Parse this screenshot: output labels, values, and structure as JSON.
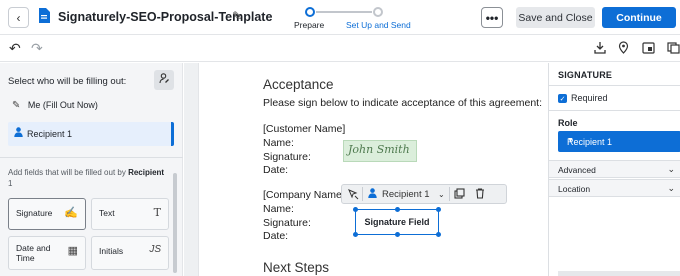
{
  "header": {
    "back_icon": "chevron-left-icon",
    "doc_icon": "document-icon",
    "title": "Signaturely-SEO-Proposal-Template",
    "edit_icon": "pencil-icon",
    "steps": [
      {
        "label": "Prepare",
        "state": "active"
      },
      {
        "label": "Set Up and Send",
        "state": "pending"
      }
    ],
    "more_label": "•••",
    "save_label": "Save and Close",
    "continue_label": "Continue",
    "accent_color": "#0d6ed6"
  },
  "toolbar": {
    "icons": [
      "undo-icon",
      "redo-icon",
      "download-icon",
      "location-pin-icon",
      "field-toggle-icon",
      "copy-icon"
    ]
  },
  "left_panel": {
    "heading": "Select who will be filling out:",
    "add_signer_icon": "person-edit-icon",
    "signers": [
      {
        "label": "Me (Fill Out Now)",
        "icon": "pen-icon"
      },
      {
        "label": "Recipient 1",
        "icon": "person-icon",
        "selected": true
      }
    ],
    "add_fields_prefix": "Add fields that will be filled out by ",
    "add_fields_name": "Recipient",
    "add_fields_suffix": "1",
    "fields": [
      {
        "label": "Signature",
        "icon": "signature-pen-icon",
        "icon_glyph": "✍"
      },
      {
        "label": "Text",
        "icon": "text-icon",
        "icon_glyph": "T"
      },
      {
        "label": "Date and Time",
        "icon": "calendar-icon",
        "icon_glyph": "▦"
      },
      {
        "label": "Initials",
        "icon": "initials-icon",
        "icon_glyph": "JS"
      }
    ]
  },
  "document": {
    "heading": "Acceptance",
    "intro": "Please sign below to indicate acceptance of this agreement:",
    "customer_block": [
      "[Customer Name]",
      "Name:",
      "Signature:",
      "Date:"
    ],
    "customer_signature": "John Smith",
    "company_block": [
      "[Company Name]",
      "Name:",
      "Signature:",
      "Date:"
    ],
    "field_toolbar": {
      "recipient_label": "Recipient 1",
      "icons": [
        "move-icon",
        "person-icon",
        "chevron-down-icon",
        "duplicate-icon",
        "trash-icon"
      ]
    },
    "signature_field_label": "Signature Field",
    "next_heading": "Next Steps"
  },
  "right_panel": {
    "title": "SIGNATURE",
    "required_label": "Required",
    "required_checked": true,
    "role_label": "Role",
    "role_value": "Recipient 1",
    "sections": [
      "Advanced",
      "Location"
    ]
  }
}
